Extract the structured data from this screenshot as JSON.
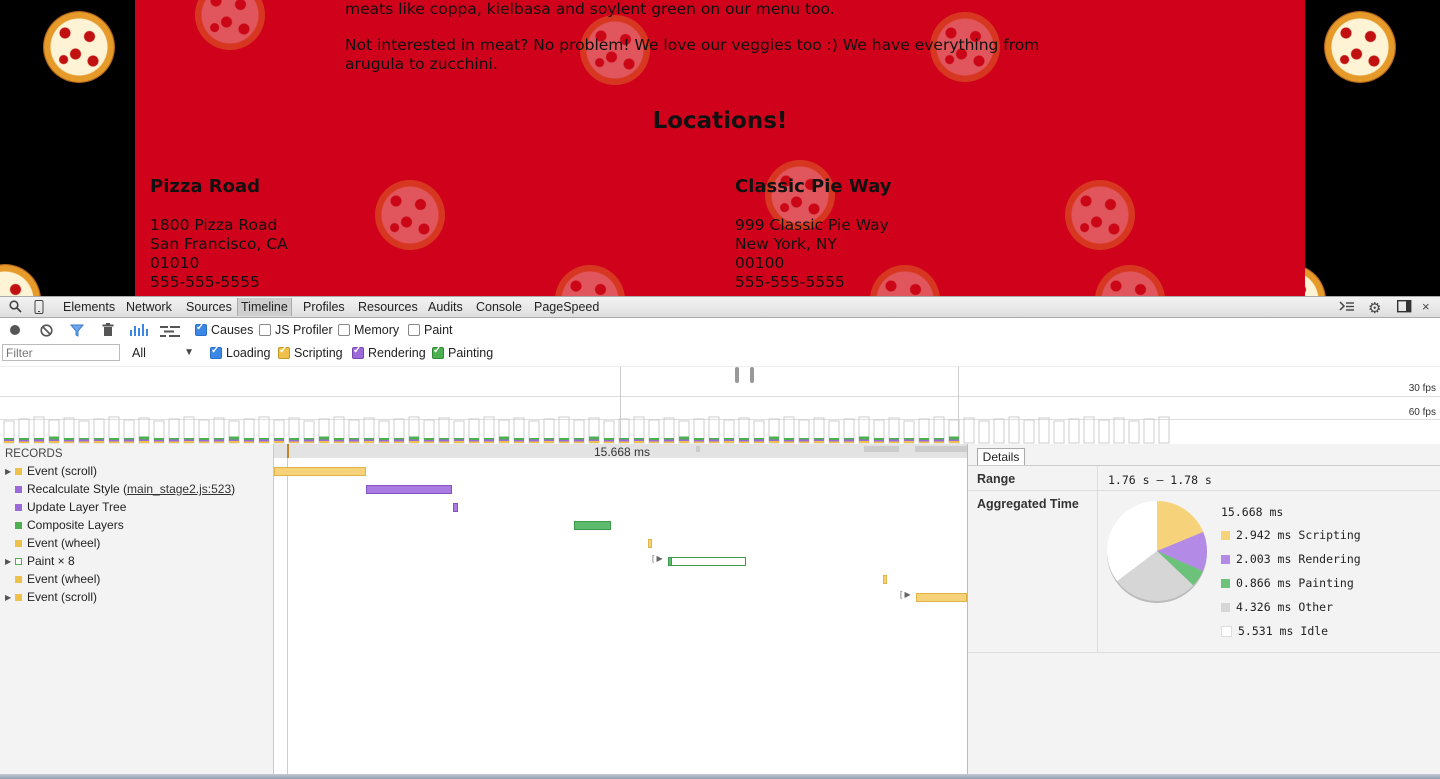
{
  "page": {
    "intro_line": "meats like coppa, kielbasa and soylent green on our menu too.",
    "veggie_line": "Not interested in meat? No problem! We love our veggies too :) We have everything from arugula to zucchini.",
    "locations_heading": "Locations!",
    "locations": [
      {
        "name": "Pizza Road",
        "street": "1800 Pizza Road",
        "city": "San Francisco, CA",
        "zip": "01010",
        "phone": "555-555-5555"
      },
      {
        "name": "Classic Pie Way",
        "street": "999 Classic Pie Way",
        "city": "New York, NY",
        "zip": "00100",
        "phone": "555-555-5555"
      }
    ]
  },
  "devtools": {
    "tabs": [
      "Elements",
      "Network",
      "Sources",
      "Timeline",
      "Profiles",
      "Resources",
      "Audits",
      "Console",
      "PageSpeed"
    ],
    "active_tab": "Timeline",
    "options": {
      "causes": "Causes",
      "js_profiler": "JS Profiler",
      "memory": "Memory",
      "paint": "Paint"
    },
    "filter_placeholder": "Filter",
    "filter_select": "All",
    "categories": {
      "loading": "Loading",
      "scripting": "Scripting",
      "rendering": "Rendering",
      "painting": "Painting"
    },
    "fps_labels": {
      "fps30": "30 fps",
      "fps60": "60 fps"
    },
    "ruler_label": "15.668 ms",
    "records_header": "RECORDS",
    "records": [
      {
        "label": "Event (scroll)",
        "color": "#f0c14a",
        "expandable": true
      },
      {
        "label": "Recalculate Style (",
        "link": "main_stage2.js:523",
        "suffix": ")",
        "color": "#9b6ad8",
        "expandable": false
      },
      {
        "label": "Update Layer Tree",
        "color": "#9b6ad8",
        "expandable": false
      },
      {
        "label": "Composite Layers",
        "color": "#4caf50",
        "expandable": false
      },
      {
        "label": "Event (wheel)",
        "color": "#f0c14a",
        "expandable": false
      },
      {
        "label": "Paint × 8",
        "color": "#4caf50",
        "expandable": true
      },
      {
        "label": "Event (wheel)",
        "color": "#f0c14a",
        "expandable": false
      },
      {
        "label": "Event (scroll)",
        "color": "#f0c14a",
        "expandable": true
      }
    ],
    "details": {
      "tab_label": "Details",
      "range_label": "Range",
      "range_value": "1.76 s – 1.78 s",
      "aggregated_label": "Aggregated Time",
      "total": "15.668 ms",
      "legend": [
        {
          "value": "2.942 ms",
          "name": "Scripting",
          "color": "#f6d37a",
          "ms": 2.942
        },
        {
          "value": "2.003 ms",
          "name": "Rendering",
          "color": "#b38be6",
          "ms": 2.003
        },
        {
          "value": "0.866 ms",
          "name": "Painting",
          "color": "#6cc27a",
          "ms": 0.866
        },
        {
          "value": "4.326 ms",
          "name": "Other",
          "color": "#d6d6d6",
          "ms": 4.326
        },
        {
          "value": "5.531 ms",
          "name": "Idle",
          "color": "#ffffff",
          "ms": 5.531
        }
      ]
    }
  }
}
